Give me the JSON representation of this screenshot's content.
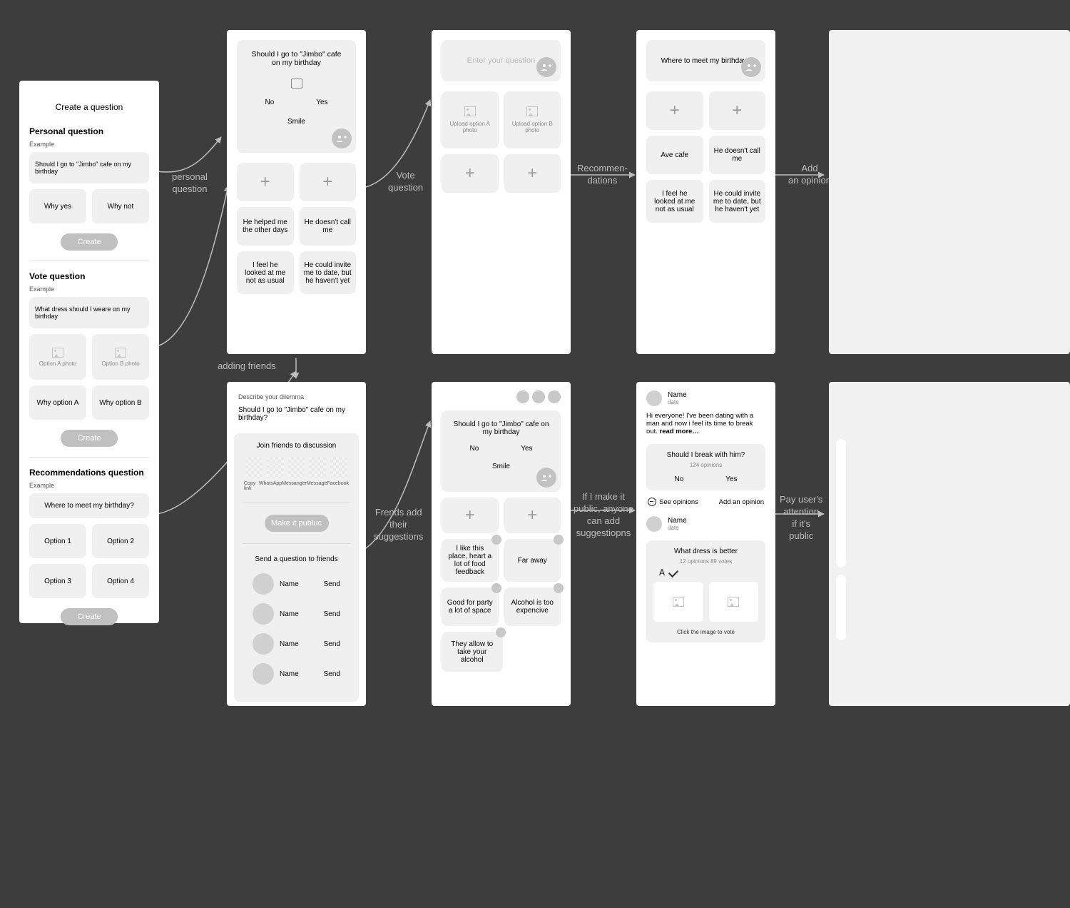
{
  "frame1": {
    "title": "Create a question",
    "personal": {
      "heading": "Personal question",
      "example": "Example",
      "q": "Should I go to \"Jimbo\" cafe on my birthday",
      "l": "Why yes",
      "r": "Why not",
      "create": "Create"
    },
    "vote": {
      "heading": "Vote question",
      "example": "Example",
      "q": "What dress should I weare on my birthday",
      "la": "Option A photo",
      "lb": "Option B photo",
      "ca": "Why option A",
      "cb": "Why option B",
      "create": "Create"
    },
    "rec": {
      "heading": "Recommendations question",
      "example": "Example",
      "q": "Where to meet my birthday?",
      "o1": "Option 1",
      "o2": "Option 2",
      "o3": "Option 3",
      "o4": "Option 4",
      "create": "Create"
    }
  },
  "frame2": {
    "q": "Should I go to \"Jimbo\" cafe on my birthday",
    "no": "No",
    "yes": "Yes",
    "smile": "Smile",
    "b1": "He helped me the other days",
    "b2": "He doesn't call me",
    "b3": "I feel he looked at me not as usual",
    "b4": "He could invite me to date, but he haven't yet"
  },
  "frame3": {
    "placeholder": "Enter your question",
    "ua": "Upload option A photo",
    "ub": "Upload option B photo"
  },
  "frame4": {
    "title": "Where to meet my birthday?",
    "a1": "Ave cafe",
    "a2": "He doesn't call me",
    "a3": "I feel he looked at me not as usual",
    "a4": "He could invite me to date, but he haven't yet"
  },
  "frame5": {
    "label": "Describe your dilemma",
    "text": "Should I go to \"Jimbo\" cafe on my birthday?",
    "join": "Join friends to discussion",
    "share": [
      "Copy link",
      "WhatsApp",
      "Messanger",
      "Message",
      "Facebook"
    ],
    "public": "Make it publuc",
    "send_hdr": "Send a question to friends",
    "name": "Name",
    "send": "Send"
  },
  "frame6": {
    "q": "Should I go to \"Jimbo\" cafe on my birthday",
    "no": "No",
    "yes": "Yes",
    "smile": "Smile",
    "s1": "I like this place, heart a lot of food feedback",
    "s2": "Far away",
    "s3": "Good for party a lot of space",
    "s4": "Alcohol is too expencive",
    "s5": "They allow to take your alcohol"
  },
  "frame7": {
    "name": "Name",
    "date": "date",
    "post": "Hi everyone! I've been dating with a man and now i feel its time to break out. ",
    "readmore": "read more…",
    "q": "Should I break with him?",
    "opcount": "124 opinions",
    "no": "No",
    "yes": "Yes",
    "see": "See opinions",
    "add": "Add an opinion",
    "q2": "What dress is better",
    "stats": "12 opinions    89 votes",
    "letterA": "A",
    "footer": "Click the image to vote"
  },
  "arrows": {
    "a1": "personal\nquestion",
    "a2": "Vote\nquestion",
    "a3": "Recommen-\ndations",
    "a4": "Add\nan opinion",
    "a5": "adding friends",
    "a6": "Frends add\ntheir\nsuggestions",
    "a7": "If I make it\npublic, anyone\ncan add\nsuggestiopns",
    "a8": "Pay user's\nattention\nif it's\npublic"
  }
}
